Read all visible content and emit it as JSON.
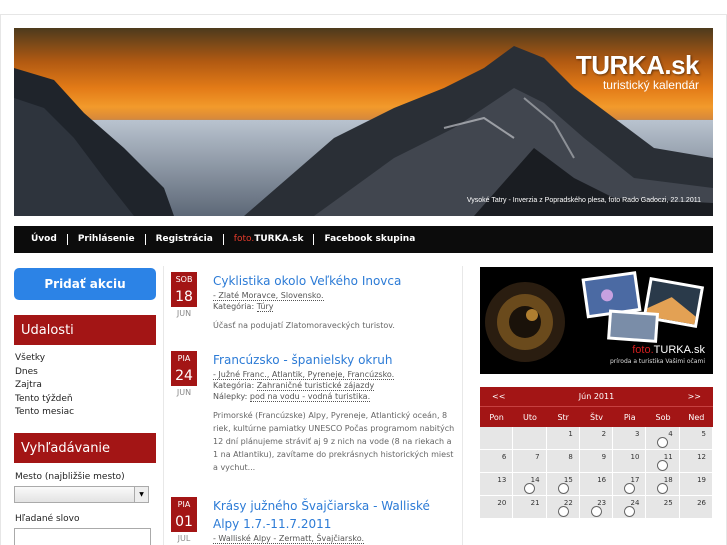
{
  "banner": {
    "title": "TURKA.sk",
    "subtitle": "turistický kalendár",
    "caption": "Vysoké Tatry - Inverzia z Popradského plesa, foto Rado Gadoczi, 22.1.2011"
  },
  "nav": {
    "items": [
      "Úvod",
      "Prihlásenie",
      "Registrácia"
    ],
    "foto_prefix": "foto.",
    "foto_suffix": "TURKA.sk",
    "facebook": "Facebook skupina"
  },
  "sidebar": {
    "add_button": "Pridať akciu",
    "events_heading": "Udalosti",
    "event_links": [
      "Všetky",
      "Dnes",
      "Zajtra",
      "Tento týždeň",
      "Tento mesiac"
    ],
    "search_heading": "Vyhľadávanie",
    "city_label": "Mesto (najbližšie mesto)",
    "city_value": "",
    "word_label": "Hľadané slovo",
    "word_value": ""
  },
  "events": [
    {
      "dow": "SOB",
      "day": "18",
      "month": "JUN",
      "title": "Cyklistika okolo Veľkého Inovca",
      "location": "- Zlaté Moravce, Slovensko.",
      "category_label": "Kategória:",
      "category": "Túry",
      "desc": "Účasť na podujatí Zlatomoraveckých turistov."
    },
    {
      "dow": "PIA",
      "day": "24",
      "month": "JUN",
      "title": "Francúzsko - španielsky okruh",
      "location": "- Južné Franc., Atlantik, Pyreneje, Francúzsko.",
      "category_label": "Kategória:",
      "category": "Zahraničné turistické zájazdy",
      "tags_label": "Nálepky:",
      "tags": "pod na vodu - vodná turistika.",
      "desc": "Primorské (Francúzske) Alpy, Pyreneje, Atlantický oceán, 8 riek, kultúrne pamiatky UNESCO Počas programom nabitých 12 dní plánujeme stráviť aj 9 z nich na vode (8 na riekach a 1 na Atlantiku), zavítame do prekrásnych historických miest a vychut..."
    },
    {
      "dow": "PIA",
      "day": "01",
      "month": "JUL",
      "title": "Krásy južného Švajčiarska - Walliské Alpy 1.7.-11.7.2011",
      "location": "- Walliské Alpy - Zermatt, Švajčiarsko."
    }
  ],
  "promo": {
    "title_prefix": "foto.",
    "title_main": "TURKA.sk",
    "subtitle": "príroda a turistika Vašimi očami"
  },
  "calendar": {
    "prev": "<<",
    "next": ">>",
    "month": "Jún 2011",
    "weekdays": [
      "Pon",
      "Uto",
      "Str",
      "Štv",
      "Pia",
      "Sob",
      "Ned"
    ],
    "rows": [
      [
        {
          "d": ""
        },
        {
          "d": ""
        },
        {
          "d": "1"
        },
        {
          "d": "2"
        },
        {
          "d": "3"
        },
        {
          "d": "4",
          "e": true
        },
        {
          "d": "5"
        }
      ],
      [
        {
          "d": "6"
        },
        {
          "d": "7"
        },
        {
          "d": "8"
        },
        {
          "d": "9"
        },
        {
          "d": "10"
        },
        {
          "d": "11",
          "e": true
        },
        {
          "d": "12"
        }
      ],
      [
        {
          "d": "13"
        },
        {
          "d": "14",
          "e": true
        },
        {
          "d": "15",
          "e": true
        },
        {
          "d": "16"
        },
        {
          "d": "17",
          "e": true
        },
        {
          "d": "18",
          "e": true
        },
        {
          "d": "19"
        }
      ],
      [
        {
          "d": "20"
        },
        {
          "d": "21"
        },
        {
          "d": "22",
          "e": true
        },
        {
          "d": "23",
          "e": true
        },
        {
          "d": "24",
          "e": true
        },
        {
          "d": "25"
        },
        {
          "d": "26"
        }
      ]
    ]
  },
  "colors": {
    "brand_red": "#a31515",
    "button_blue": "#2c83e6",
    "link_blue": "#2c7bd6",
    "nav_black": "#0c0c0c"
  }
}
